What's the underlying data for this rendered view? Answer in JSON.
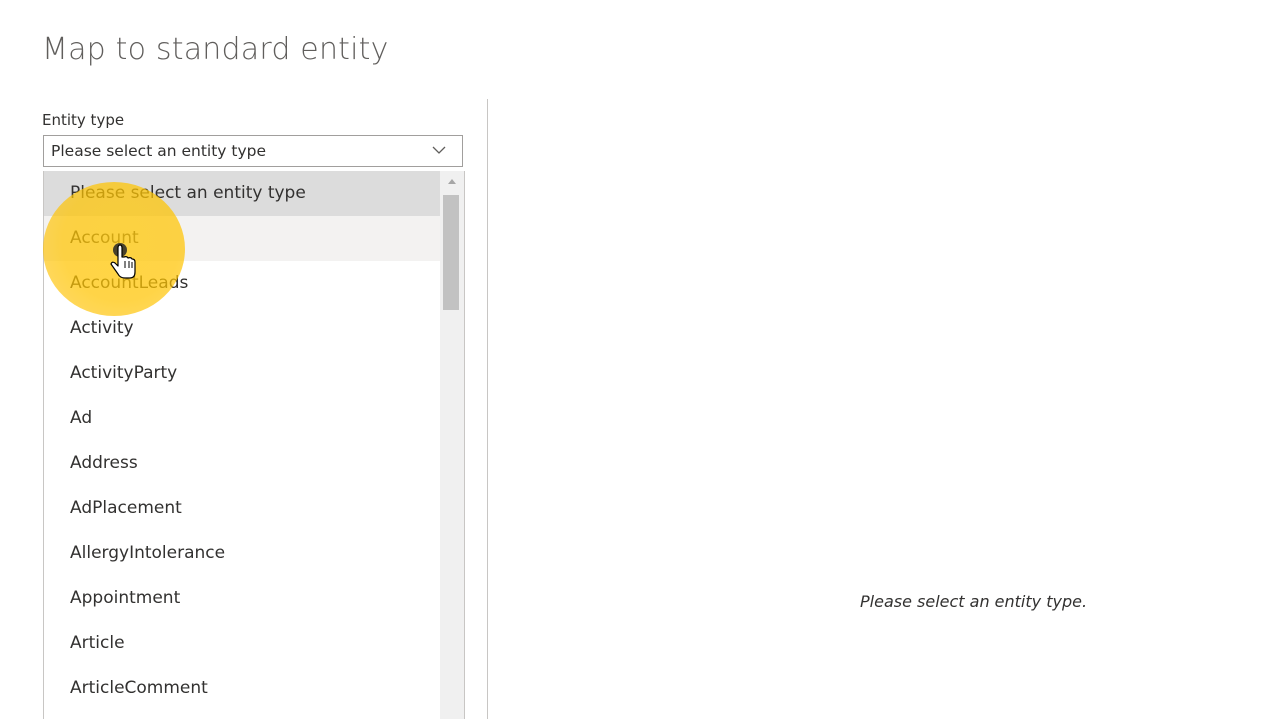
{
  "page": {
    "title": "Map to standard entity"
  },
  "entity_type": {
    "label": "Entity type",
    "selected_value": "Please select an entity type",
    "options": [
      "Please select an entity type",
      "Account",
      "AccountLeads",
      "Activity",
      "ActivityParty",
      "Ad",
      "Address",
      "AdPlacement",
      "AllergyIntolerance",
      "Appointment",
      "Article",
      "ArticleComment"
    ]
  },
  "details_panel": {
    "empty_message": "Please select an entity type."
  },
  "icons": {
    "dropdown": "chevron-down-icon",
    "cursor": "hand-pointer-icon",
    "scroll": "scroll-up-arrow-icon"
  },
  "colors": {
    "selected_option_bg": "#dcdcdc",
    "hovered_option_bg": "#f3f2f1",
    "click_highlight": "#ffc40e"
  }
}
